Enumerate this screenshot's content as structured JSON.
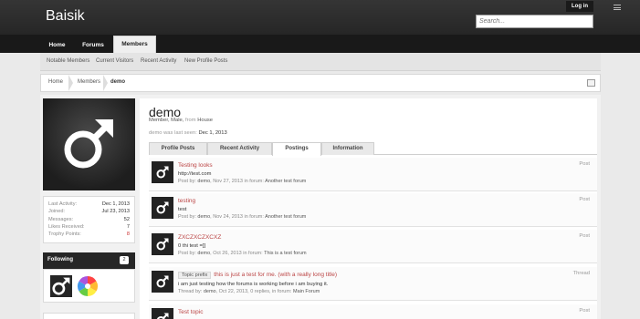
{
  "header": {
    "logo": "Baisik",
    "login_label": "Log in",
    "search_placeholder": "Search...",
    "menu_icon": "list-icon"
  },
  "nav": {
    "tabs": [
      {
        "label": "Home"
      },
      {
        "label": "Forums"
      },
      {
        "label": "Members",
        "active": true
      }
    ]
  },
  "subnav": {
    "items": [
      "Notable Members",
      "Current Visitors",
      "Recent Activity",
      "New Profile Posts"
    ]
  },
  "breadcrumb": {
    "items": [
      "Home",
      "Members",
      "demo"
    ]
  },
  "profile": {
    "username": "demo",
    "role": "Member, Male,",
    "from_label": "from",
    "location": "House",
    "last_seen_label": "demo was last seen:",
    "last_seen_value": "Dec 1, 2013",
    "avatar_icon": "male-symbol-icon"
  },
  "stats": [
    {
      "label": "Last Activity:",
      "value": "Dec 1, 2013"
    },
    {
      "label": "Joined:",
      "value": "Jul 23, 2013"
    },
    {
      "label": "Messages:",
      "value": "52"
    },
    {
      "label": "Likes Received:",
      "value": "7"
    },
    {
      "label": "Trophy Points:",
      "value": "8"
    }
  ],
  "following": {
    "title": "Following",
    "count": "2"
  },
  "tabs": [
    {
      "label": "Profile Posts"
    },
    {
      "label": "Recent Activity"
    },
    {
      "label": "Postings",
      "active": true
    },
    {
      "label": "Information"
    }
  ],
  "postings": [
    {
      "title": "Testing looks",
      "snippet": "http://test.com",
      "by_label": "Post by:",
      "author": "demo",
      "rest": ", Nov 27, 2013 in forum:",
      "forum": "Another test forum",
      "type": "Post"
    },
    {
      "title": "testing",
      "snippet": "test",
      "by_label": "Post by:",
      "author": "demo",
      "rest": ", Nov 24, 2013 in forum:",
      "forum": "Another test forum",
      "type": "Post"
    },
    {
      "title": "ZXCZXCZXCXZ",
      "snippet": "0 thi test =]]",
      "by_label": "Post by:",
      "author": "demo",
      "rest": ", Oct 26, 2013 in forum:",
      "forum": "This is a test forum",
      "type": "Post"
    },
    {
      "prefix": "Topic prefix",
      "title": "this is just a test for me. (with a really long title)",
      "snippet": "i am just testing how the forums is working before i am buying it.",
      "by_label": "Thread by:",
      "author": "demo",
      "rest": ", Oct 22, 2013, 0 replies, in forum:",
      "forum": "Main Forum",
      "type": "Thread"
    },
    {
      "title": "Test topic",
      "snippet": "",
      "by_label": "",
      "author": "",
      "rest": "",
      "forum": "",
      "type": "Post"
    }
  ]
}
